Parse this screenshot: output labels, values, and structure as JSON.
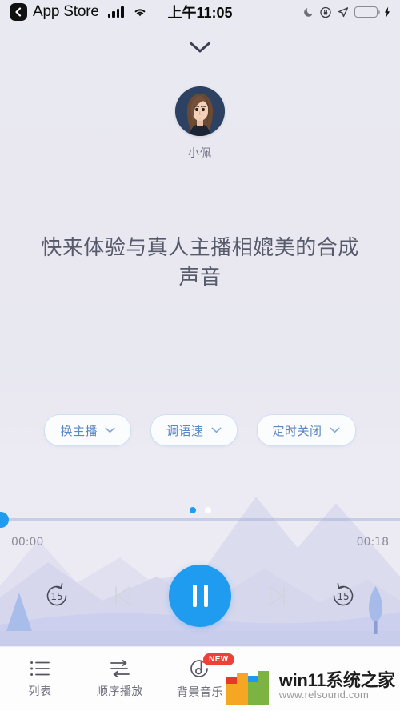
{
  "status_bar": {
    "back_app": "App Store",
    "time": "上午11:05",
    "icons": [
      "back-chevron-icon",
      "signal-bars-icon",
      "wifi-icon",
      "moon-icon",
      "rotation-lock-icon",
      "location-arrow-icon",
      "battery-icon",
      "charging-bolt-icon"
    ],
    "battery_color": "#34d94b"
  },
  "player": {
    "collapse_icon": "chevron-down-icon",
    "speaker_name": "小佩",
    "headline": "快来体验与真人主播相媲美的合成声音",
    "options": [
      {
        "label": "换主播",
        "icon": "chevron-down-icon"
      },
      {
        "label": "调语速",
        "icon": "chevron-down-icon"
      },
      {
        "label": "定时关闭",
        "icon": "chevron-down-icon"
      }
    ],
    "page_dots": {
      "count": 2,
      "active_index": 0
    },
    "progress": {
      "current_time": "00:00",
      "total_time": "00:18",
      "percent": 0
    },
    "controls": {
      "rewind_label": "15",
      "forward_label": "15",
      "previous_icon": "skip-previous-icon",
      "next_icon": "skip-next-icon",
      "play_state_icon": "pause-icon"
    },
    "accent_color": "#1f9cf0"
  },
  "bottom_nav": [
    {
      "label": "列表",
      "icon": "list-icon",
      "badge": null
    },
    {
      "label": "顺序播放",
      "icon": "sequence-play-icon",
      "badge": null
    },
    {
      "label": "背景音乐",
      "icon": "music-disc-icon",
      "badge": "NEW"
    }
  ],
  "watermark": {
    "title": "win11系统之家",
    "url": "www.relsound.com"
  }
}
